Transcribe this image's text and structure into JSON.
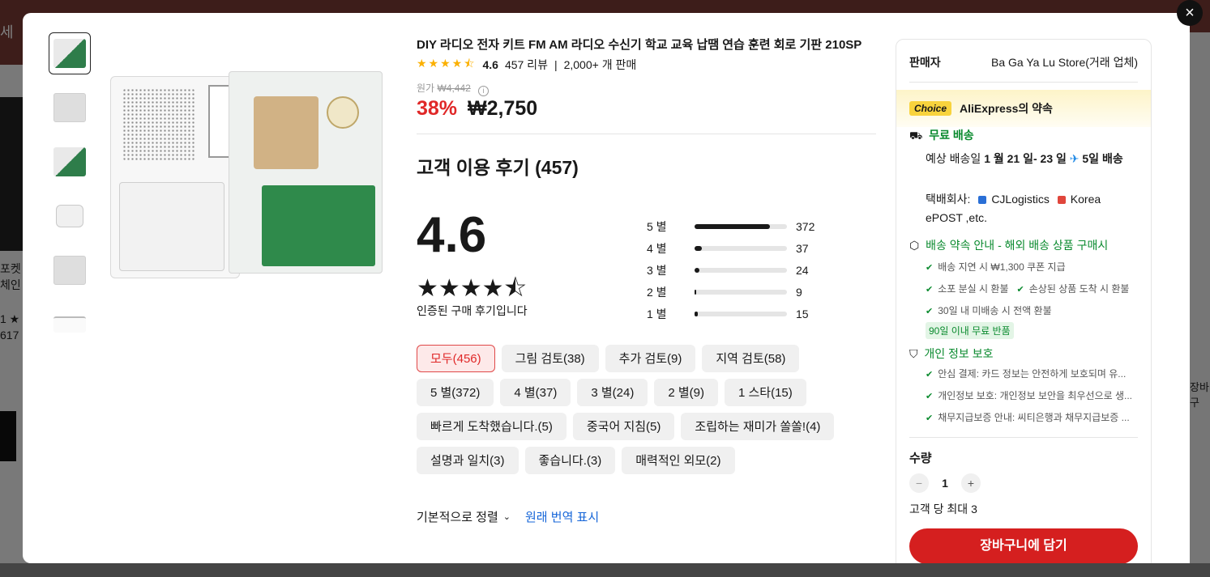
{
  "background": {
    "banner_text": "세",
    "left_text_lines": [
      "포켓 심",
      "체인 히",
      "1 ★",
      "617"
    ],
    "right_text": "장바구"
  },
  "close_label": "×",
  "thumbnails": [
    {
      "icon": "product-thumb-1"
    },
    {
      "icon": "product-thumb-2"
    },
    {
      "icon": "product-thumb-3"
    },
    {
      "icon": "product-thumb-4"
    },
    {
      "icon": "product-thumb-5"
    },
    {
      "icon": "product-thumb-6"
    }
  ],
  "product": {
    "title": "DIY 라디오 전자 키트 FM AM 라디오 수신기 학교 교육 납땜 연습 훈련 회로 기판 210SP",
    "rating": "4.6",
    "stars": "★★★★⯪",
    "review_count": "457 리뷰",
    "separator": "|",
    "sold": "2,000+ 개 판매",
    "orig_price_label": "원가",
    "orig_price": "₩4,442",
    "info_icon": "i",
    "discount": "38%",
    "price": "₩2,750"
  },
  "reviews": {
    "heading": "고객 이용 후기 (457)",
    "average": "4.6",
    "big_stars": "★★★★⯪",
    "verified": "인증된 구매 후기입니다",
    "breakdown": [
      {
        "label": "5 별",
        "count": "372",
        "fraction": 0.814
      },
      {
        "label": "4 별",
        "count": "37",
        "fraction": 0.081
      },
      {
        "label": "3 별",
        "count": "24",
        "fraction": 0.053
      },
      {
        "label": "2 별",
        "count": "9",
        "fraction": 0.02
      },
      {
        "label": "1 별",
        "count": "15",
        "fraction": 0.033
      }
    ],
    "filters": [
      {
        "label": "모두(456)",
        "active": true
      },
      {
        "label": "그림 검토(38)",
        "active": false
      },
      {
        "label": "추가 검토(9)",
        "active": false
      },
      {
        "label": "지역 검토(58)",
        "active": false
      },
      {
        "label": "5 별(372)",
        "active": false
      },
      {
        "label": "4 별(37)",
        "active": false
      },
      {
        "label": "3 별(24)",
        "active": false
      },
      {
        "label": "2 별(9)",
        "active": false
      },
      {
        "label": "1 스타(15)",
        "active": false
      },
      {
        "label": "빠르게 도착했습니다.(5)",
        "active": false
      },
      {
        "label": "중국어 지침(5)",
        "active": false
      },
      {
        "label": "조립하는 재미가 쏠쏠!(4)",
        "active": false
      },
      {
        "label": "설명과 일치(3)",
        "active": false
      },
      {
        "label": "좋습니다.(3)",
        "active": false
      },
      {
        "label": "매력적인 외모(2)",
        "active": false
      }
    ],
    "sort_label": "기본적으로 정렬",
    "sort_chevron": "⌄",
    "translate_link": "원래 번역 표시"
  },
  "panel": {
    "seller_label": "판매자",
    "seller_name": "Ba Ga Ya Lu Store(거래 업체)",
    "choice_badge": "Choice",
    "promise_title": "AliExpress의 약속",
    "ship_icon": "⛟",
    "ship_title": "무료 배송",
    "ship_est_prefix": "예상 배송일",
    "ship_est_dates": "1 월 21 일- 23 일",
    "plane_icon": "✈",
    "ship_est_days": "5일 배송",
    "carrier_label": "택배회사:",
    "carrier_1": "CJLogistics",
    "carrier_2": "Korea ePOST ,etc.",
    "policy_icon": "⬡",
    "policy_title": "배송 약속 안내 - 해외 배송 상품 구매시",
    "check": "✔",
    "policies": [
      "배송 지연 시 ₩1,300 쿠폰 지급",
      "소포 분실 시 환불",
      "손상된 상품 도착 시 환불",
      "30일 내 미배송 시 전액 환불"
    ],
    "return_badge": "90일 이내 무료 반품",
    "privacy_icon": "⛉",
    "privacy_title": "개인 정보 보호",
    "privacy_items": [
      "안심 결제: 카드 정보는 안전하게 보호되며 유...",
      "개인정보 보호: 개인정보 보안을 최우선으로 생...",
      "채무지급보증 안내: 씨티은행과 채무지급보증 ..."
    ],
    "qty_label": "수량",
    "qty_minus": "−",
    "qty_value": "1",
    "qty_plus": "+",
    "qty_max": "고객 당 최대 3",
    "cart_button": "장바구니에 담기"
  },
  "colors": {
    "accent_red": "#d51f1f",
    "discount_red": "#e02828",
    "green": "#0a8a2e",
    "star_yellow": "#fbb000",
    "link_blue": "#1565d8"
  }
}
